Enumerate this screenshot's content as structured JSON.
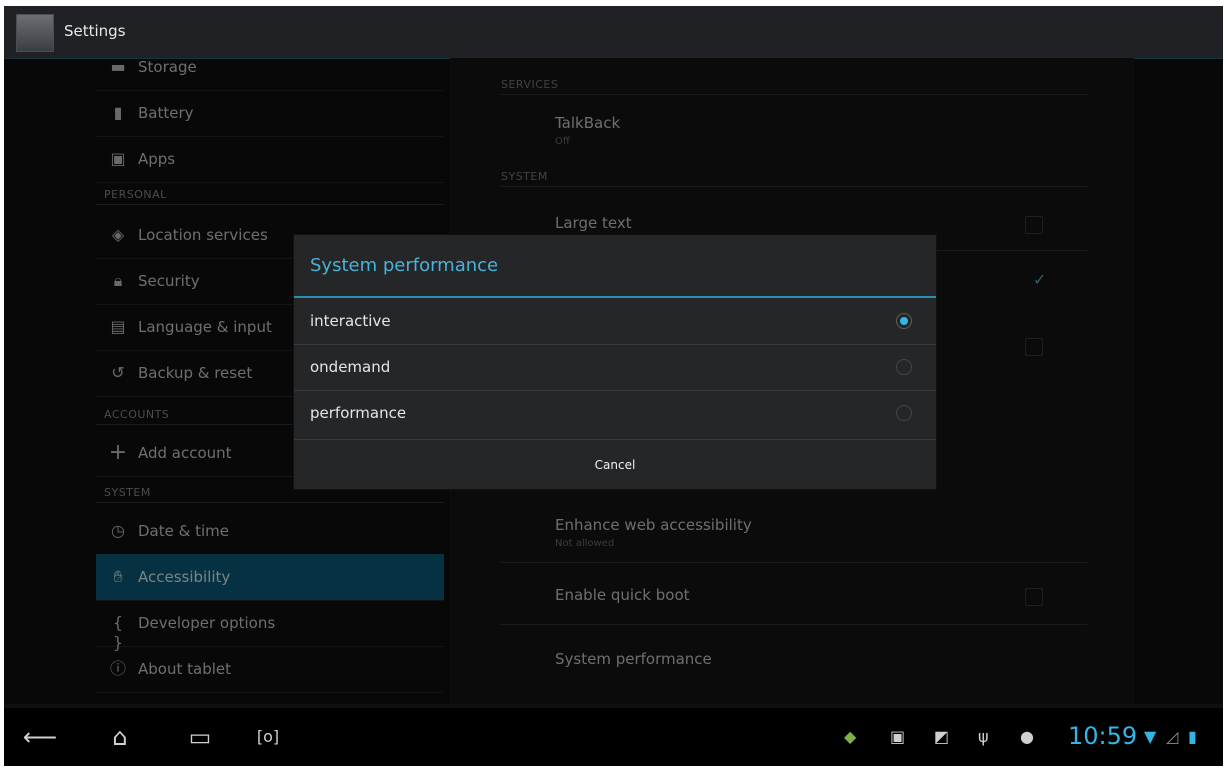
{
  "app": {
    "title": "Settings"
  },
  "left_list": {
    "top_items": [
      {
        "label": "Storage",
        "icon": "storage-icon"
      },
      {
        "label": "Battery",
        "icon": "battery-icon"
      },
      {
        "label": "Apps",
        "icon": "apps-icon"
      }
    ],
    "headers": {
      "personal": "PERSONAL",
      "accounts": "ACCOUNTS",
      "system": "SYSTEM"
    },
    "personal_items": [
      {
        "label": "Location services",
        "icon": "location-icon"
      },
      {
        "label": "Security",
        "icon": "lock-icon"
      },
      {
        "label": "Language & input",
        "icon": "keyboard-icon"
      },
      {
        "label": "Backup & reset",
        "icon": "backup-icon"
      }
    ],
    "account_items": [
      {
        "label": "Add account",
        "icon": "plus-icon"
      }
    ],
    "system_items": [
      {
        "label": "Date & time",
        "icon": "clock-icon"
      },
      {
        "label": "Accessibility",
        "icon": "hand-icon",
        "selected": true
      },
      {
        "label": "Developer options",
        "icon": "braces-icon"
      },
      {
        "label": "About tablet",
        "icon": "info-icon"
      }
    ]
  },
  "right_panel": {
    "services_header": "SERVICES",
    "talkback": {
      "title": "TalkBack",
      "summary": "Off"
    },
    "system_header": "SYSTEM",
    "large_text": {
      "title": "Large text"
    },
    "enhance": {
      "title": "Enhance web accessibility",
      "summary": "Not allowed"
    },
    "quick_boot": {
      "title": "Enable quick boot"
    },
    "system_performance": {
      "title": "System performance"
    }
  },
  "dialog": {
    "title": "System performance",
    "options": [
      {
        "label": "interactive",
        "selected": true
      },
      {
        "label": "ondemand",
        "selected": false
      },
      {
        "label": "performance",
        "selected": false
      }
    ],
    "cancel_label": "Cancel"
  },
  "status_bar": {
    "time": "10:59",
    "accent": "#33b5e5"
  }
}
